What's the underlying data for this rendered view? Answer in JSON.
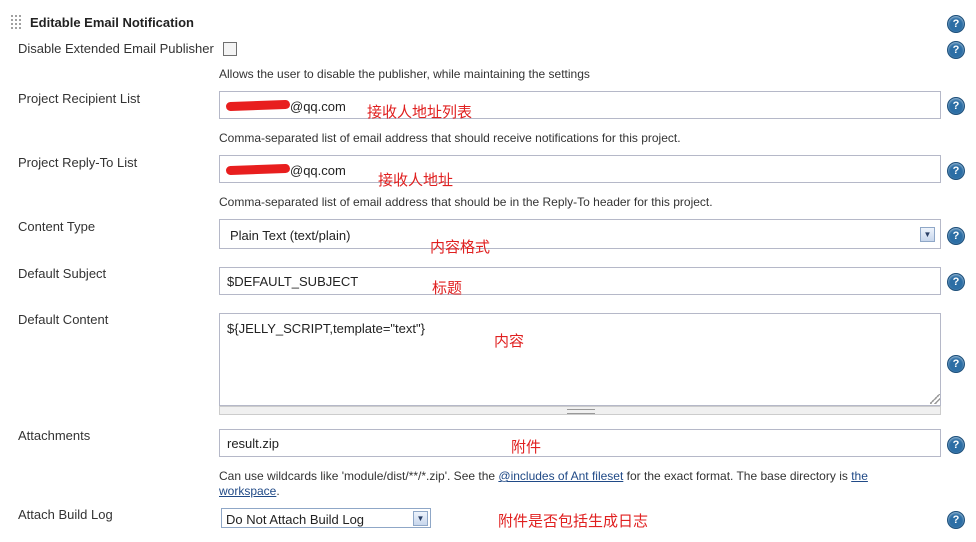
{
  "section": {
    "title": "Editable Email Notification"
  },
  "disable_publisher": {
    "label": "Disable Extended Email Publisher",
    "checked": false,
    "description": "Allows the user to disable the publisher, while maintaining the settings"
  },
  "recipient_list": {
    "label": "Project Recipient List",
    "value_suffix": "@qq.com",
    "description": "Comma-separated list of email address that should receive notifications for this project.",
    "note": "接收人地址列表"
  },
  "reply_to": {
    "label": "Project Reply-To List",
    "value_suffix": "@qq.com",
    "description": "Comma-separated list of email address that should be in the Reply-To header for this project.",
    "note": "接收人地址"
  },
  "content_type": {
    "label": "Content Type",
    "selected": "Plain Text (text/plain)",
    "note": "内容格式"
  },
  "default_subject": {
    "label": "Default Subject",
    "value": "$DEFAULT_SUBJECT",
    "note": "标题"
  },
  "default_content": {
    "label": "Default Content",
    "value": "${JELLY_SCRIPT,template=\"text\"}",
    "note": "内容"
  },
  "attachments": {
    "label": "Attachments",
    "value": "result.zip",
    "note": "附件",
    "desc_part1": "Can use wildcards like 'module/dist/**/*.zip'. See the ",
    "desc_link1": "@includes of Ant fileset",
    "desc_part2": " for the exact format. The base directory is ",
    "desc_link2a": "the",
    "desc_link2b": "workspace",
    "desc_part3": "."
  },
  "attach_build_log": {
    "label": "Attach Build Log",
    "selected": "Do Not Attach Build Log",
    "note": "附件是否包括生成日志"
  },
  "icons": {
    "help": "help-icon",
    "dropdown": "chevron-down-icon",
    "handle": "drag-handle-icon"
  },
  "colors": {
    "note_red": "#e02020",
    "help_blue": "#2c6ea5",
    "link": "#204a87"
  }
}
